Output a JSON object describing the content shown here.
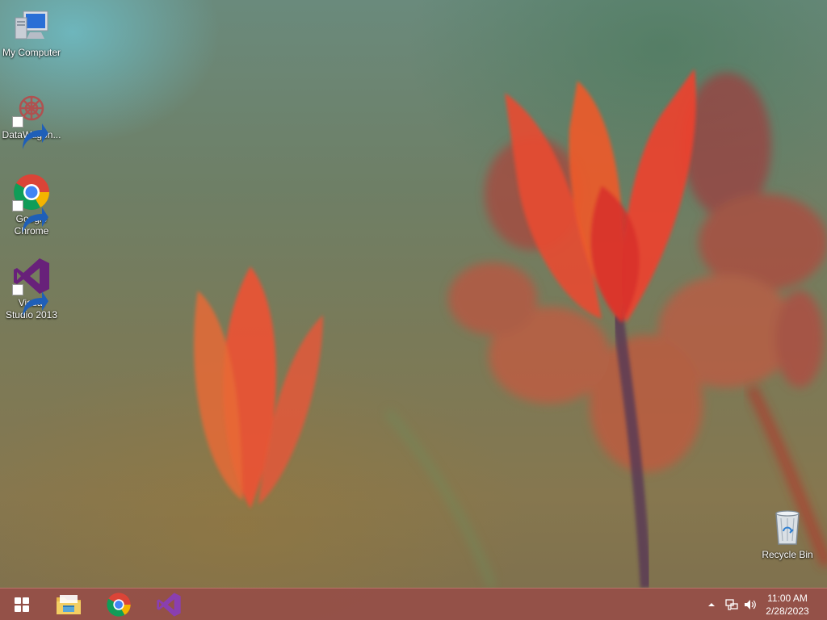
{
  "desktop": {
    "icons": [
      {
        "label": "My Computer",
        "icon": "computer-icon"
      },
      {
        "label": "DataWagon...",
        "icon": "datawagon-icon"
      },
      {
        "label": "Google Chrome",
        "icon": "chrome-icon"
      },
      {
        "label": "Visual Studio 2013",
        "icon": "visual-studio-icon"
      },
      {
        "label": "Recycle Bin",
        "icon": "recycle-bin-icon"
      }
    ]
  },
  "taskbar": {
    "pinned": [
      {
        "icon": "start-icon"
      },
      {
        "icon": "file-explorer-icon"
      },
      {
        "icon": "chrome-icon"
      },
      {
        "icon": "visual-studio-icon"
      }
    ],
    "tray": {
      "icons": [
        "show-hidden-icons-chevron-icon",
        "network-icon",
        "volume-icon"
      ],
      "time": "11:00 AM",
      "date": "2/28/2023"
    }
  },
  "colors": {
    "taskbar": "#964e48",
    "flower": "#e8452c",
    "vs_purple": "#68217a"
  }
}
